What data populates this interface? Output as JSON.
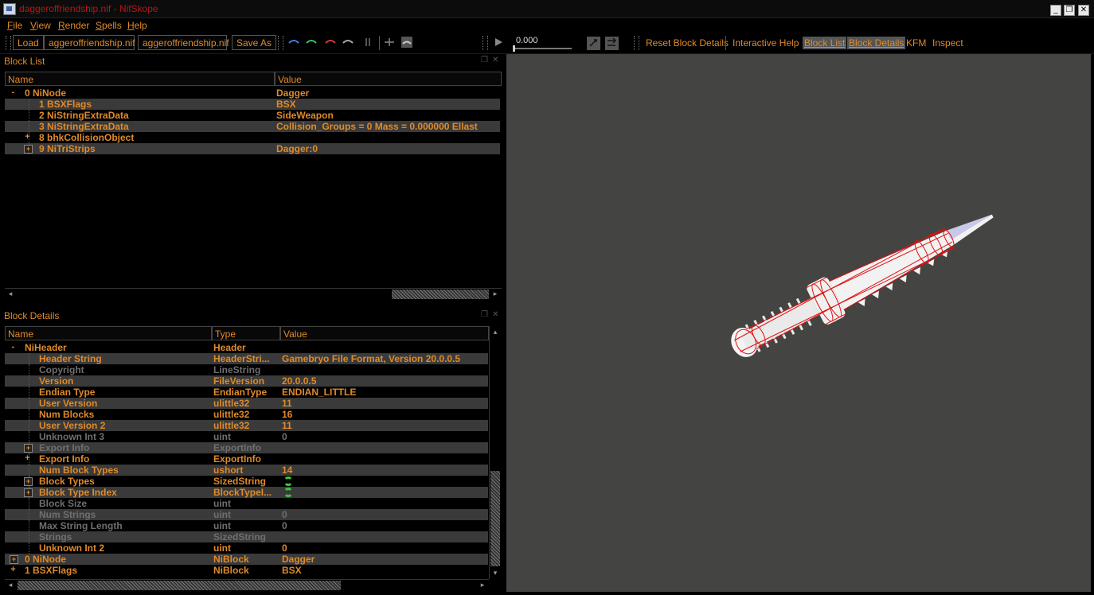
{
  "window": {
    "title": "daggeroffriendship.nif - NifSkope",
    "buttons": {
      "minimize": "_",
      "maximize": "❐",
      "close": "✕"
    }
  },
  "menu": [
    "File",
    "View",
    "Render",
    "Spells",
    "Help"
  ],
  "toolbar": {
    "load": "Load",
    "file1": "aggeroffriendship.nif",
    "file2": "aggeroffriendship.nif",
    "save_as": "Save As",
    "anim_time": "0.000",
    "reset_block_details": "Reset Block Details",
    "interactive_help": "Interactive Help",
    "block_list": "Block List",
    "block_details": "Block Details",
    "kfm": "KFM",
    "inspect": "Inspect"
  },
  "block_list": {
    "title": "Block List",
    "columns": [
      "Name",
      "Value"
    ],
    "rows": [
      {
        "name": "0 NiNode",
        "value": "Dagger",
        "exp": "-"
      },
      {
        "name": "1 BSXFlags",
        "value": "BSX"
      },
      {
        "name": "2 NiStringExtraData",
        "value": "SideWeapon"
      },
      {
        "name": "3 NiStringExtraData",
        "value": "Collision_Groups = 0  Mass = 0.000000  Ellast"
      },
      {
        "name": "8 bhkCollisionObject",
        "value": "",
        "exp": "+"
      },
      {
        "name": "9 NiTriStrips",
        "value": "Dagger:0",
        "exp": "+"
      }
    ]
  },
  "block_details": {
    "title": "Block Details",
    "columns": [
      "Name",
      "Type",
      "Value"
    ],
    "rows": [
      {
        "name": "NiHeader",
        "type": "Header",
        "value": "",
        "exp": "-",
        "root": true
      },
      {
        "name": "Header String",
        "type": "HeaderStri...",
        "value": "Gamebryo File Format, Version 20.0.0.5"
      },
      {
        "name": "Copyright",
        "type": "LineString",
        "value": "",
        "dim": true
      },
      {
        "name": "Version",
        "type": "FileVersion",
        "value": "20.0.0.5"
      },
      {
        "name": "Endian Type",
        "type": "EndianType",
        "value": "ENDIAN_LITTLE"
      },
      {
        "name": "User Version",
        "type": "ulittle32",
        "value": "11"
      },
      {
        "name": "Num Blocks",
        "type": "ulittle32",
        "value": "16"
      },
      {
        "name": "User Version 2",
        "type": "ulittle32",
        "value": "11"
      },
      {
        "name": "Unknown Int 3",
        "type": "uint",
        "value": "0",
        "dim": true
      },
      {
        "name": "Export Info",
        "type": "ExportInfo",
        "value": "",
        "dim": true,
        "exp": "+"
      },
      {
        "name": "Export Info",
        "type": "ExportInfo",
        "value": "",
        "exp": "+"
      },
      {
        "name": "Num Block Types",
        "type": "ushort",
        "value": "14"
      },
      {
        "name": "Block Types",
        "type": "SizedString",
        "value": "",
        "exp": "+",
        "icon": true
      },
      {
        "name": "Block Type Index",
        "type": "BlockTypeI...",
        "value": "",
        "exp": "+",
        "icon": true
      },
      {
        "name": "Block Size",
        "type": "uint",
        "value": "",
        "dim": true
      },
      {
        "name": "Num Strings",
        "type": "uint",
        "value": "0",
        "dim": true
      },
      {
        "name": "Max String Length",
        "type": "uint",
        "value": "0",
        "dim": true
      },
      {
        "name": "Strings",
        "type": "SizedString",
        "value": "",
        "dim": true
      },
      {
        "name": "Unknown Int 2",
        "type": "uint",
        "value": "0"
      },
      {
        "name": "0 NiNode",
        "type": "NiBlock",
        "value": "Dagger",
        "exp": "+",
        "root": true
      },
      {
        "name": "1 BSXFlags",
        "type": "NiBlock",
        "value": "BSX",
        "exp": "+",
        "root": true
      }
    ]
  },
  "colors": {
    "accent": "#e08a2a",
    "title_red": "#b21818",
    "viewport": "#444443",
    "wire": "#e01010"
  }
}
